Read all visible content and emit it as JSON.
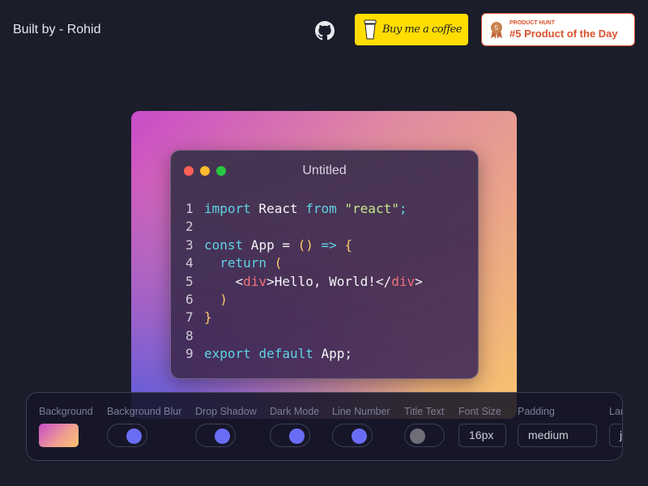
{
  "header": {
    "built_by": "Built by - Rohid",
    "github_icon": "github-icon",
    "bmc_label": "Buy me a coffee",
    "ph_small": "PRODUCT HUNT",
    "ph_main": "#5 Product of the Day",
    "ph_medal": "5"
  },
  "window": {
    "title": "Untitled",
    "dots": [
      "#ff5f57",
      "#febc2e",
      "#28c840"
    ]
  },
  "colors": {
    "kw": "#5fd3e6",
    "txt": "#f4f4f6",
    "str": "#c3e88d",
    "pun": "#ffcb6b",
    "tag": "#f07178"
  },
  "code": [
    [
      [
        "kw",
        "import"
      ],
      [
        "txt",
        " React "
      ],
      [
        "kw",
        "from"
      ],
      [
        "txt",
        " "
      ],
      [
        "str",
        "\"react\""
      ],
      [
        "kw",
        ";"
      ]
    ],
    [],
    [
      [
        "kw",
        "const"
      ],
      [
        "txt",
        " App = "
      ],
      [
        "pun",
        "()"
      ],
      [
        "txt",
        " "
      ],
      [
        "kw",
        "=>"
      ],
      [
        "txt",
        " "
      ],
      [
        "pun",
        "{"
      ]
    ],
    [
      [
        "txt",
        "  "
      ],
      [
        "kw",
        "return"
      ],
      [
        "txt",
        " "
      ],
      [
        "pun",
        "("
      ]
    ],
    [
      [
        "txt",
        "    <"
      ],
      [
        "tag",
        "div"
      ],
      [
        "txt",
        ">Hello, World!</"
      ],
      [
        "tag",
        "div"
      ],
      [
        "txt",
        ">"
      ]
    ],
    [
      [
        "txt",
        "  "
      ],
      [
        "pun",
        ")"
      ]
    ],
    [
      [
        "pun",
        "}"
      ]
    ],
    [],
    [
      [
        "kw",
        "export"
      ],
      [
        "txt",
        " "
      ],
      [
        "kw",
        "default"
      ],
      [
        "txt",
        " App;"
      ]
    ]
  ],
  "toolbar": {
    "background_label": "Background",
    "blur_label": "Background Blur",
    "blur_on": true,
    "shadow_label": "Drop Shadow",
    "shadow_on": true,
    "dark_label": "Dark Mode",
    "dark_on": true,
    "linenum_label": "Line Number",
    "linenum_on": true,
    "titletext_label": "Title Text",
    "titletext_on": false,
    "fontsize_label": "Font Size",
    "fontsize_value": "16px",
    "padding_label": "Padding",
    "padding_value": "medium",
    "language_label": "Language",
    "language_value": "javascript"
  }
}
